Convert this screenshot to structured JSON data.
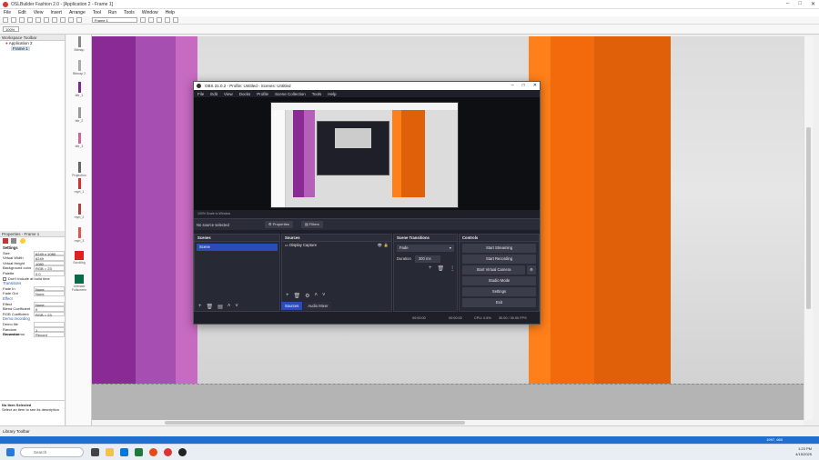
{
  "app": {
    "title": "OSLBuilder Fashion 2.0 - [Application 2 - Frame 1]",
    "menu": [
      "File",
      "Edit",
      "View",
      "Insert",
      "Arrange",
      "Tool",
      "Run",
      "Tools",
      "Window",
      "Help"
    ],
    "frame_select": "Frame 1",
    "zoom": "100%"
  },
  "workspace": {
    "title": "Workspace Toolbar",
    "tree": [
      "Application 2",
      "Frame 1"
    ]
  },
  "palette": {
    "items": [
      {
        "label": "Bitmap",
        "color": "#888888"
      },
      {
        "label": "Bitmap 2",
        "color": "#aaaaaa"
      },
      {
        "label": "bitr_1",
        "color": "#7b2a8c"
      },
      {
        "label": "bitr_2",
        "color": "#9a9a9a"
      },
      {
        "label": "bitr_3",
        "color": "#c46aa0"
      },
      {
        "label": "Projection",
        "color": "#666666"
      },
      {
        "label": "myrt_1",
        "color": "#c33"
      },
      {
        "label": "myrt_2",
        "color": "#a44"
      },
      {
        "label": "myrt_3",
        "color": "#d55"
      },
      {
        "label": "Scrolling",
        "color": "#e02020"
      },
      {
        "label": "Ultimate Fullscreen",
        "color": "#0a6b4a"
      }
    ]
  },
  "properties": {
    "title": "Properties - Frame 1",
    "section_settings": "Settings",
    "rows": [
      {
        "k": "Size",
        "v": "6249 x 1080"
      },
      {
        "k": "Virtual Width",
        "v": "6249"
      },
      {
        "k": "Virtual Height",
        "v": "1080"
      },
      {
        "k": "Background color",
        "v": "RGB = 23"
      },
      {
        "k": "Palette",
        "v": "0.0"
      }
    ],
    "checkbox_label": "Don't include at build time",
    "section_transitions": "Transitions",
    "rows2": [
      {
        "k": "Fade In",
        "v": "None"
      },
      {
        "k": "Fade Out",
        "v": "None"
      }
    ],
    "section_effect": "Effect",
    "rows3": [
      {
        "k": "Effect",
        "v": "None"
      },
      {
        "k": "Blend Coefficient",
        "v": "0"
      },
      {
        "k": "RGB Coefficient",
        "v": "RGB = 23"
      }
    ],
    "section_demo": "Demo recording",
    "rows4": [
      {
        "k": "Demo file",
        "v": ""
      },
      {
        "k": "Random Generator",
        "v": "1"
      },
      {
        "k": "Record demo",
        "v": "Record"
      }
    ]
  },
  "noitem": {
    "title": "No Item Selected",
    "desc": "Select an item to see its description"
  },
  "library": {
    "title": "Library Toolbar"
  },
  "stage": {
    "stripes": [
      {
        "color": "#8a2a95"
      },
      {
        "color": "#a64fb0"
      },
      {
        "color": "#c76ac2"
      },
      {
        "color": "#ff7f1a"
      },
      {
        "color": "#f26a0c"
      },
      {
        "color": "#e0600a"
      }
    ]
  },
  "obs": {
    "title": "OBS 31.0.2 - Profile: Untitled - Scenes: Untitled",
    "menu": [
      "File",
      "Edit",
      "View",
      "Docks",
      "Profile",
      "Scene Collection",
      "Tools",
      "Help"
    ],
    "zoom_label": "100%   Scale to Window",
    "no_source": "No source selected",
    "properties_btn": "Properties",
    "filters_btn": "Filters",
    "docks": {
      "scenes": {
        "title": "Scenes",
        "items": [
          "Scene"
        ]
      },
      "sources": {
        "title": "Sources",
        "items": [
          "Display Capture"
        ]
      },
      "transitions": {
        "title": "Scene Transitions",
        "type": "Fade",
        "duration_label": "Duration",
        "duration": "300 ms"
      },
      "controls": {
        "title": "Controls",
        "buttons": [
          "Start Streaming",
          "Start Recording",
          "Start Virtual Camera",
          "Studio Mode",
          "Settings",
          "Exit"
        ]
      }
    },
    "tabs": [
      "Sources",
      "Audio Mixer"
    ],
    "status": {
      "stream": "00:00:00",
      "rec": "00:00:00",
      "cpu": "CPU: 0.6%",
      "fps": "30.00 / 30.00 FPS"
    }
  },
  "statusbar": {
    "text": "1997, 660"
  },
  "taskbar": {
    "search_placeholder": "Search",
    "time": "1:23 PM",
    "date": "4/15/2025"
  }
}
